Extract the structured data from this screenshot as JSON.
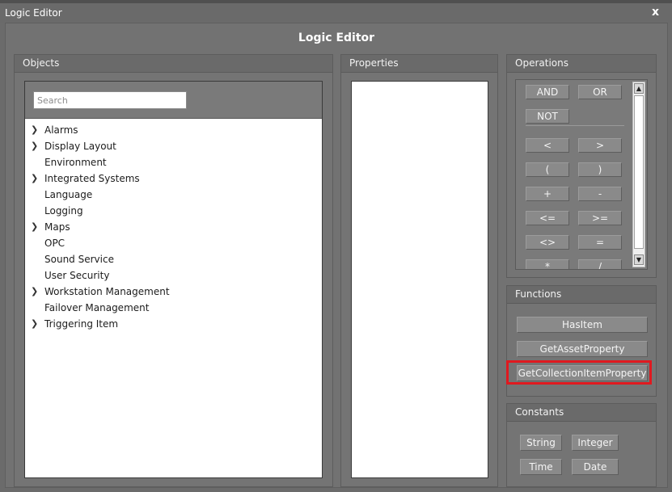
{
  "window": {
    "title": "Logic Editor",
    "close_glyph": "x"
  },
  "dialog": {
    "heading": "Logic Editor"
  },
  "objects": {
    "title": "Objects",
    "search_placeholder": "Search",
    "items": [
      {
        "label": "Alarms",
        "expandable": true
      },
      {
        "label": "Display Layout",
        "expandable": true
      },
      {
        "label": "Environment",
        "expandable": false
      },
      {
        "label": "Integrated Systems",
        "expandable": true
      },
      {
        "label": "Language",
        "expandable": false
      },
      {
        "label": "Logging",
        "expandable": false
      },
      {
        "label": "Maps",
        "expandable": true
      },
      {
        "label": "OPC",
        "expandable": false
      },
      {
        "label": "Sound Service",
        "expandable": false
      },
      {
        "label": "User Security",
        "expandable": false
      },
      {
        "label": "Workstation Management",
        "expandable": true
      },
      {
        "label": "Failover Management",
        "expandable": false
      },
      {
        "label": "Triggering Item",
        "expandable": true
      }
    ]
  },
  "properties": {
    "title": "Properties"
  },
  "operations": {
    "title": "Operations",
    "buttons": [
      "AND",
      "OR",
      "NOT",
      "<",
      ">",
      "(",
      ")",
      "+",
      "-",
      "<=",
      ">=",
      "<>",
      "=",
      "*",
      "/"
    ]
  },
  "functions": {
    "title": "Functions",
    "buttons": [
      "HasItem",
      "GetAssetProperty",
      "GetCollectionItemProperty"
    ]
  },
  "constants": {
    "title": "Constants",
    "buttons": [
      "String",
      "Integer",
      "Time",
      "Date"
    ]
  },
  "colors": {
    "highlight": "#e0191f",
    "panel": "#747474",
    "window": "#6b6b6b"
  }
}
